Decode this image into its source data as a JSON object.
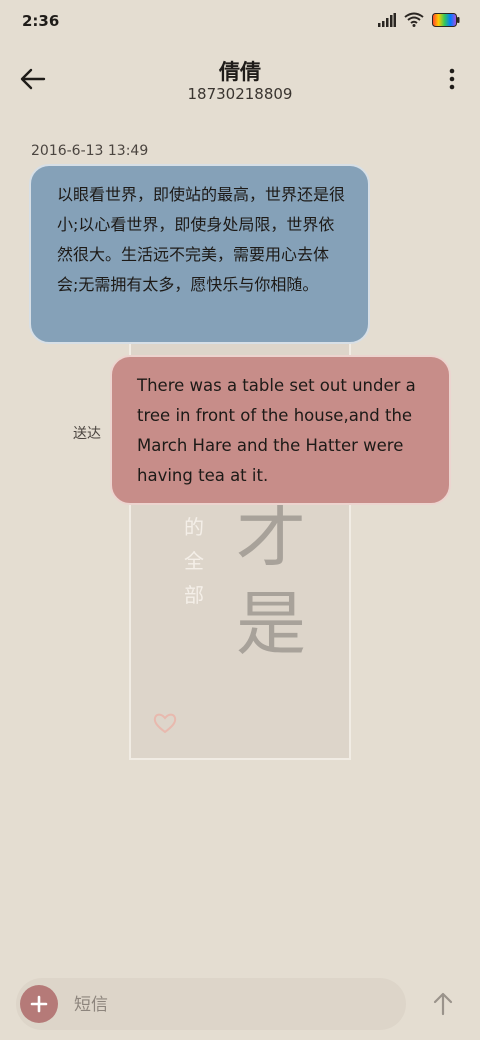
{
  "status_bar": {
    "time": "2:36",
    "icons": [
      "signal-icon",
      "wifi-icon",
      "battery-icon"
    ]
  },
  "header": {
    "contact_name": "倩倩",
    "contact_number": "18730218809"
  },
  "conversation": {
    "timestamp": "2016-6-13 13:49",
    "messages": [
      {
        "direction": "incoming",
        "text": "以眼看世界，即使站的最高，世界还是很小;以心看世界，即使身处局限，世界依然很大。生活远不完美，需要用心去体会;无需拥有太多，愿快乐与你相随。"
      },
      {
        "direction": "outgoing",
        "text": "There was a table set out under a tree in front of the house,and the March Hare and the Hatter were having tea at it.",
        "status": "送达"
      }
    ]
  },
  "wallpaper": {
    "big_text": "才是",
    "small_text": "的全部"
  },
  "composer": {
    "placeholder": "短信"
  },
  "colors": {
    "background": "#e4ddd1",
    "incoming_bubble": "#85a1b8",
    "outgoing_bubble": "#c78d89",
    "accent": "#b57a78"
  }
}
